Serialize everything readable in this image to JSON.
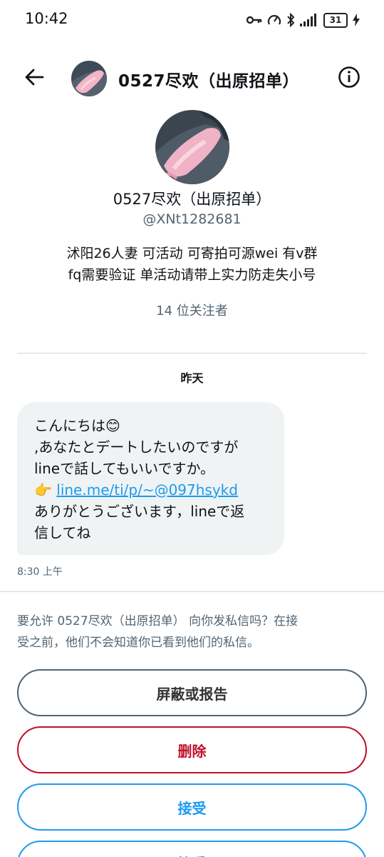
{
  "status_bar": {
    "time": "10:42",
    "battery": "31",
    "icons": [
      "key-icon",
      "speedometer-icon",
      "bluetooth-icon",
      "signal-icon",
      "charging-icon"
    ]
  },
  "header": {
    "title": "0527尽欢（出原招单）",
    "back_icon": "arrow-left-icon",
    "info_icon": "info-icon"
  },
  "profile": {
    "name": "0527尽欢（出原招单）",
    "handle": "@XNt1282681",
    "bio_line1": "沭阳26人妻 可活动 可寄拍可源wei 有v群",
    "bio_line2": "fq需要验证 单活动请带上实力防走失小号",
    "followers": "14 位关注者"
  },
  "conversation": {
    "date_label": "昨天",
    "message": {
      "line1": "こんにちは😊",
      "line2": ",あなたとデートしたいのですが",
      "line3": "lineで話してもいいですか。",
      "line4_emoji": "👉",
      "link": "line.me/ti/p/~@097hsykd",
      "line5": "ありがとうございます，lineで返",
      "line6": "信してね"
    },
    "time": "8:30 上午"
  },
  "request": {
    "line1": "要允许 0527尽欢（出原招单） 向你发私信吗？在接",
    "line2": "受之前，他们不会知道你已看到他们的私信。"
  },
  "buttons": {
    "block": "屏蔽或报告",
    "delete": "删除",
    "accept": "接受",
    "extra": "接受"
  },
  "colors": {
    "accent": "#1d9bf0",
    "danger": "#c0102a",
    "secondary_text": "#536471",
    "bubble": "#eff3f4"
  }
}
